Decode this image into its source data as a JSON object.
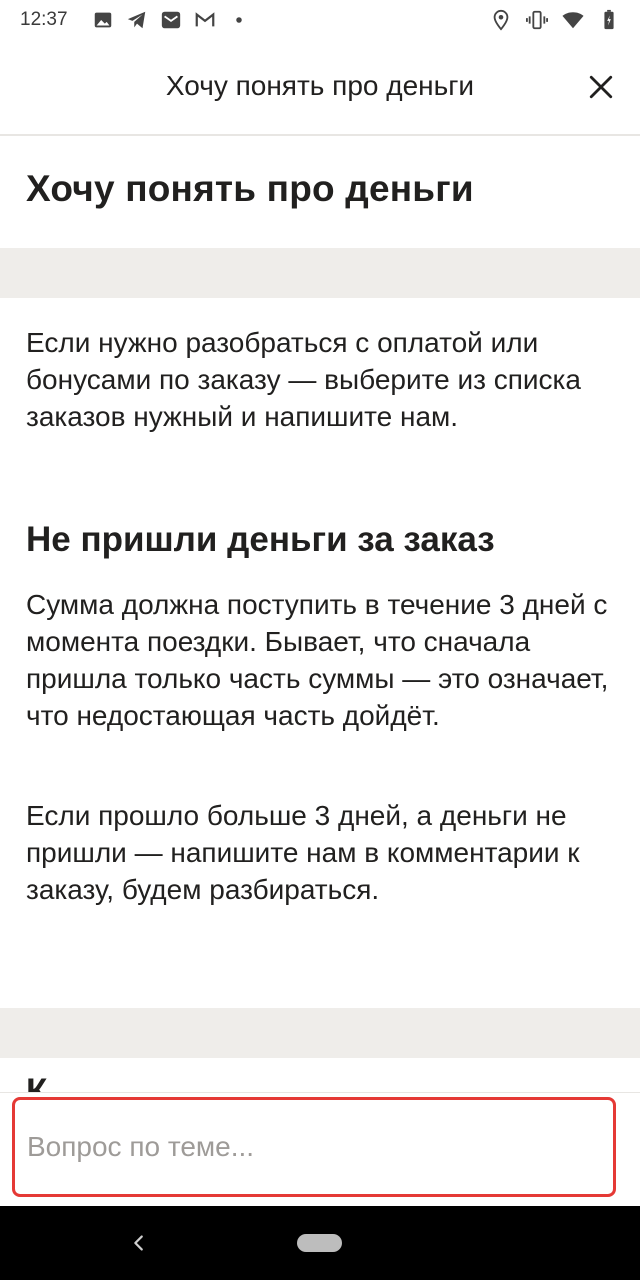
{
  "status_bar": {
    "time": "12:37"
  },
  "header": {
    "title": "Хочу понять про деньги"
  },
  "content": {
    "page_title": "Хочу понять про деньги",
    "intro": "Если нужно разобраться с оплатой или бонусами по заказу — выберите из списка заказов нужный и напишите нам.",
    "section_heading": "Не пришли деньги за заказ",
    "paragraph_1": "Сумма должна поступить в течение 3 дней с момента поездки. Бывает, что сначала пришла только часть суммы — это означает, что недостающая часть дойдёт.",
    "paragraph_2": "Если прошло больше 3 дней, а деньги не пришли — напишите нам в комментарии к заказу, будем разбираться.",
    "next_heading_partial": "К"
  },
  "input": {
    "placeholder": "Вопрос по теме...",
    "value": ""
  },
  "colors": {
    "text": "#21201f",
    "band": "#efedea",
    "input_border": "#e53935",
    "placeholder": "#9e9b98"
  },
  "icons": {
    "status_left": [
      "image-icon",
      "telegram-icon",
      "mail-icon",
      "gmail-icon",
      "dot-icon"
    ],
    "status_right": [
      "location-icon",
      "vibrate-icon",
      "wifi-icon",
      "battery-icon"
    ],
    "header": "close-icon",
    "nav": [
      "back-icon",
      "home-pill"
    ]
  }
}
